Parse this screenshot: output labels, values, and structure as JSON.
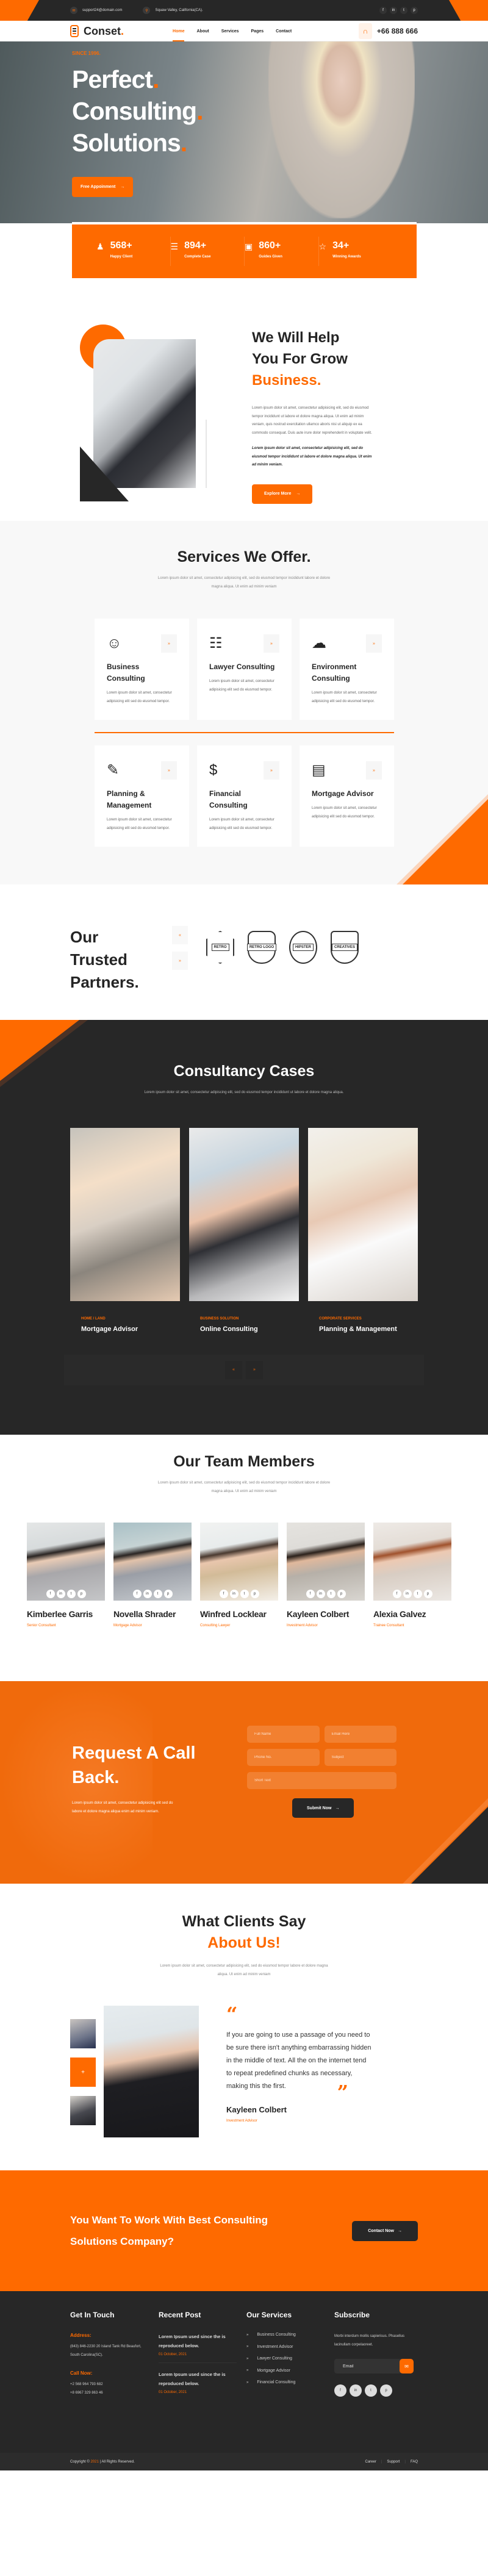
{
  "topbar": {
    "email": "support24@domain.com",
    "address": "Squaw Valley, California(CA).",
    "email_icon": "mail-icon",
    "address_icon": "map-pin-icon",
    "social": [
      "f",
      "in",
      "t",
      "p"
    ]
  },
  "header": {
    "brand": "Conset",
    "brand_dot": ".",
    "nav": [
      {
        "label": "Home",
        "active": true
      },
      {
        "label": "About"
      },
      {
        "label": "Services"
      },
      {
        "label": "Pages"
      },
      {
        "label": "Contact"
      }
    ],
    "phone": "+66 888 666"
  },
  "hero": {
    "since": "SINCE 1996.",
    "lines": [
      "Perfect",
      "Consulting",
      "Solutions"
    ],
    "dot": ".",
    "button": "Free Appoinment",
    "arrow": "→"
  },
  "stats": [
    {
      "icon": "users-icon",
      "glyph": "♟",
      "value": "568+",
      "label": "Happy Client"
    },
    {
      "icon": "document-icon",
      "glyph": "☰",
      "value": "894+",
      "label": "Complete Case"
    },
    {
      "icon": "monitor-icon",
      "glyph": "▣",
      "value": "860+",
      "label": "Guides Given"
    },
    {
      "icon": "award-icon",
      "glyph": "☆",
      "value": "34+",
      "label": "Winning Awards"
    }
  ],
  "about": {
    "title_line1": "We Will Help",
    "title_line2": "You For Grow",
    "title_accent": "Business.",
    "para": "Lorem ipsum dolor sit amet, consectetur adipisicing elit, sed do eiusmod tempor incididunt ut labore et dolore magna aliqua. Ut enim ad minim veniam, quis nostrud exercitation ullamco aboris nisi ut aliquip ex ea commodo consequat. Duis aute irure dolor reprehenderit in voluptate velit.",
    "para_bold": "Lorem ipsum dolor sit amet, consectetur adipisicing elit, sed do eiusmod tempor incididunt ut labore et dolore magna aliqua. Ut enim ad minim veniam.",
    "button": "Explore More",
    "arrow": "→"
  },
  "services": {
    "title": "Services We Offer.",
    "subtitle": "Lorem ipsum dolor sit amet, consectetur adipisicing elit, sed do eiusmod tempor incididunt labore et dolore magna aliqua. Ut enim ad minim veniam",
    "arrow": "»",
    "items": [
      {
        "title": "Business Consulting",
        "icon": "team-chat-icon",
        "glyph": "☺",
        "text": "Lorem ipsum dolor sit amet, consectetur adipisicing elit sed do eiusmod tempor."
      },
      {
        "title": "Lawyer Consulting",
        "icon": "document-user-icon",
        "glyph": "☷",
        "text": "Lorem ipsum dolor sit amet, consectetur adipisicing elit sed do eiusmod tempor."
      },
      {
        "title": "Environment Consulting",
        "icon": "cloud-sun-icon",
        "glyph": "☁",
        "text": "Lorem ipsum dolor sit amet, consectetur adipisicing elit sed do eiusmod tempor."
      },
      {
        "title": "Planning & Management",
        "icon": "pen-tool-icon",
        "glyph": "✎",
        "text": "Lorem ipsum dolor sit amet, consectetur adipisicing elit sed do eiusmod tempor."
      },
      {
        "title": "Financial Consulting",
        "icon": "user-dollar-icon",
        "glyph": "$",
        "text": "Lorem ipsum dolor sit amet, consectetur adipisicing elit sed do eiusmod tempor."
      },
      {
        "title": "Mortgage Advisor",
        "icon": "invoice-icon",
        "glyph": "▤",
        "text": "Lorem ipsum dolor sit amet, consectetur adipisicing elit sed do eiusmod tempor."
      }
    ]
  },
  "partners": {
    "title_line1": "Our Trusted",
    "title_line2": "Partners.",
    "prev": "«",
    "next": "»",
    "logos": [
      "RETRO",
      "RETRO LOGO",
      "HIPSTER",
      "CREATIVES"
    ]
  },
  "cases": {
    "title": "Consultancy Cases",
    "subtitle": "Lorem ipsum dolor sit amet, consectetur adipiscing elit, sed do eiusmod tempor incididunt ut labore et dolore magna aliqua.",
    "items": [
      {
        "category": "HOME / LAND",
        "title": "Mortgage Advisor"
      },
      {
        "category": "BUSINESS SOLUTION",
        "title": "Online Consulting"
      },
      {
        "category": "CORPORATE SERVICES",
        "title": "Planning & Management"
      }
    ],
    "prev": "«",
    "next": "»"
  },
  "team": {
    "title": "Our Team Members",
    "subtitle": "Lorem ipsum dolor sit amet, consectetur adipisicing elit, sed do eiusmod tempor incididunt labore et dolore magna aliqua. Ut enim ad minim veniam",
    "social": [
      "f",
      "in",
      "t",
      "p"
    ],
    "members": [
      {
        "name": "Kimberlee Garris",
        "role": "Senior Consultant"
      },
      {
        "name": "Novella Shrader",
        "role": "Mortgage Advisor"
      },
      {
        "name": "Winfred Locklear",
        "role": "Consulting Lawyer"
      },
      {
        "name": "Kayleen Colbert",
        "role": "Investment Advisor"
      },
      {
        "name": "Alexia Galvez",
        "role": "Trainee Consultant"
      }
    ]
  },
  "callback": {
    "title_line1": "Request A Call",
    "title_line2": "Back.",
    "text": "Lorem ipsum dolor sit amet, consectetur adipisicing elit sed do labore et dolore magna aliqua enim ad minim veniam.",
    "fields": {
      "name": "Full Name",
      "email": "Email Here",
      "phone": "Phone No.",
      "subject": "Subject",
      "message": "Short Text"
    },
    "button": "Submit Now",
    "arrow": "→"
  },
  "testimonial": {
    "title": "What Clients Say",
    "title_accent": "About Us!",
    "subtitle": "Lorem ipsum dolor sit amet, consectetur adipisicing elit, sed do eiusmod tempor labore et dolore magna aliqua. Ut enim ad minim veniam",
    "quote": "If you are going to use a passage of you need to be sure there isn't anything embarrassing hidden in the middle of text. All the on the internet tend to repeat predefined chunks as necessary, making this the first.",
    "name": "Kayleen Colbert",
    "role": "Investment Advisor",
    "open_quote": "“",
    "close_quote": "”",
    "active_thumb": "+"
  },
  "cta": {
    "title": "You Want To Work With Best Consulting Solutions Company?",
    "button": "Contact Now",
    "arrow": "→"
  },
  "footer": {
    "contact": {
      "title": "Get In Touch",
      "address_label": "Address:",
      "address": "(843) 846-2230 20 Island Tank Rd Beaufort, South Carolina(SC).",
      "call_label": "Call Now:",
      "phone1": "+2 568 964 793 682",
      "phone2": "+8 6967 329 863 46"
    },
    "posts": {
      "title": "Recent Post",
      "items": [
        {
          "title": "Lorem Ipsum used since the is reproduced below.",
          "date": "01 October, 2021"
        },
        {
          "title": "Lorem Ipsum used since the is reproduced below.",
          "date": "01 October, 2021"
        }
      ]
    },
    "services": {
      "title": "Our Services",
      "items": [
        "Business Consulting",
        "Investment Advisor",
        "Lawyer Consulting",
        "Mortgage Advisor",
        "Financial Consulting"
      ]
    },
    "subscribe": {
      "title": "Subscribe",
      "text": "Morbi interdum mollis sapierisus. Phasellus lacinullam corpelaoreet.",
      "placeholder": "Email",
      "social": [
        "f",
        "in",
        "t",
        "p"
      ]
    },
    "copyright_pre": "Copyright ©",
    "copyright_year": "2021",
    "copyright_post": "| All Rights Reserved.",
    "links": [
      "Career",
      "Support",
      "FAQ"
    ]
  },
  "colors": {
    "accent": "#fe6a00",
    "dark": "#272727",
    "light_bg": "#f8f8f8"
  }
}
